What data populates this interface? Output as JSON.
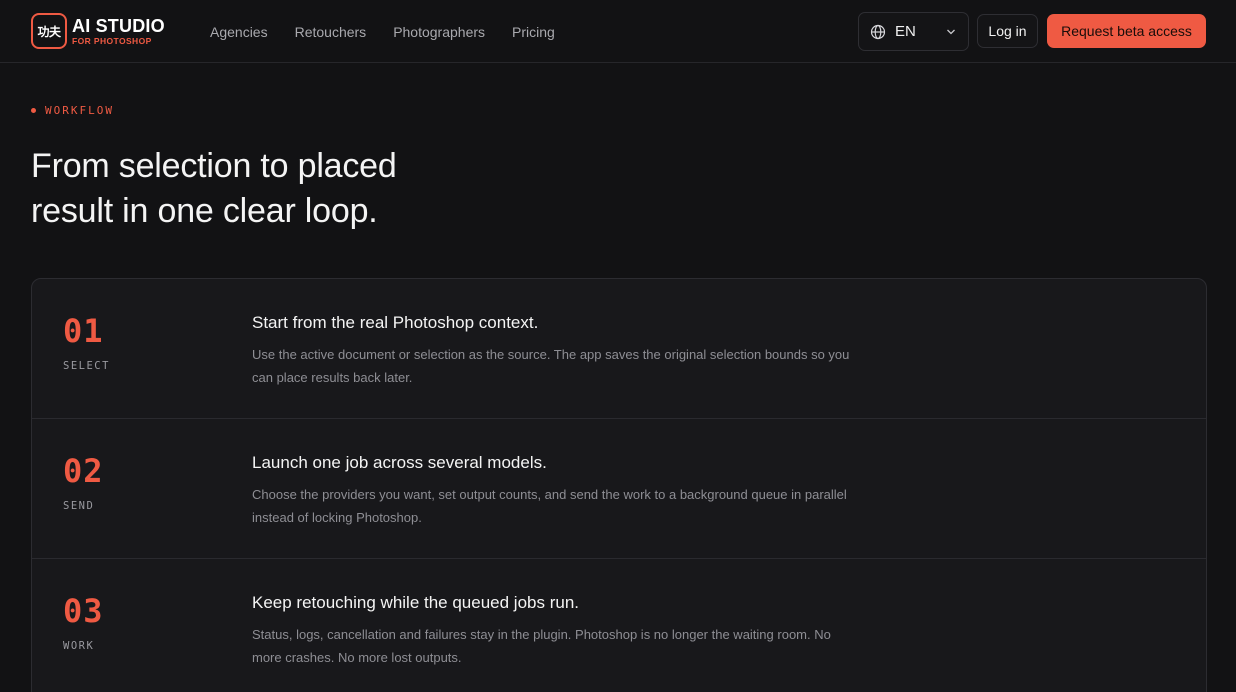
{
  "brand": {
    "mark": "功夫",
    "title": "AI STUDIO",
    "subtitle": "FOR PHOTOSHOP",
    "accent_color": "#ef5a43"
  },
  "nav": {
    "items": [
      "Agencies",
      "Retouchers",
      "Photographers",
      "Pricing"
    ]
  },
  "language": {
    "icon": "globe-icon",
    "selected": "EN",
    "chevron": "chevron-down-icon"
  },
  "actions": {
    "login_label": "Log in",
    "beta_label": "Request beta access"
  },
  "hero": {
    "eyebrow": "WORKFLOW",
    "headline_line1": "From selection to placed",
    "headline_line2": "result in one clear loop."
  },
  "steps": [
    {
      "number": "01",
      "label": "SELECT",
      "title": "Start from the real Photoshop context.",
      "desc_line1": "Use the active document or selection as the source. The app saves the original selection bounds so you",
      "desc_line2": "can place results back later."
    },
    {
      "number": "02",
      "label": "SEND",
      "title": "Launch one job across several models.",
      "desc_line1": "Choose the providers you want, set output counts, and send the work to a background queue in parallel",
      "desc_line2": "instead of locking Photoshop."
    },
    {
      "number": "03",
      "label": "WORK",
      "title": "Keep retouching while the queued jobs run.",
      "desc_line1": "Status, logs, cancellation and failures stay in the plugin. Photoshop is no longer the waiting room. No",
      "desc_line2": "more crashes. No more lost outputs."
    }
  ]
}
